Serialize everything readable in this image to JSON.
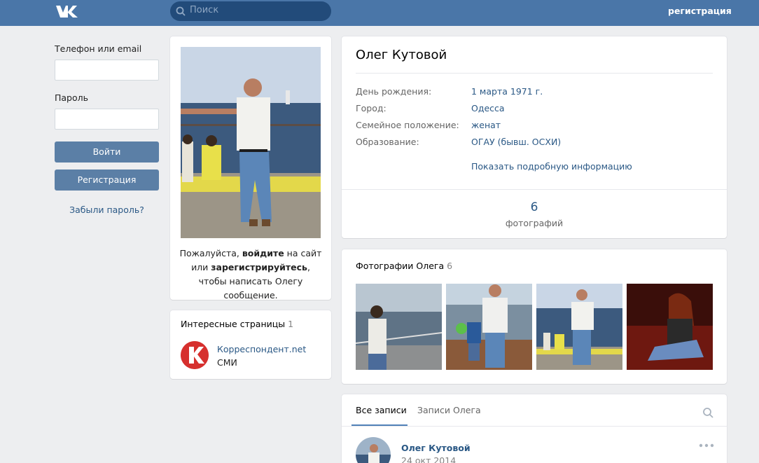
{
  "header": {
    "search_placeholder": "Поиск",
    "register_link": "регистрация"
  },
  "login": {
    "phone_label": "Телефон или email",
    "password_label": "Пароль",
    "login_button": "Войти",
    "register_button": "Регистрация",
    "forgot_link": "Забыли пароль?"
  },
  "profile": {
    "name": "Олег Кутовой",
    "note_prefix": "Пожалуйста, ",
    "note_login": "войдите",
    "note_middle": " на сайт или ",
    "note_register": "зарегистрируйтесь",
    "note_suffix": ", чтобы написать Олегу сообщение.",
    "fields": [
      {
        "label": "День рождения:",
        "value": "1 марта 1971 г."
      },
      {
        "label": "Город:",
        "value": "Одесса"
      },
      {
        "label": "Семейное положение:",
        "value": "женат"
      },
      {
        "label": "Образование:",
        "value": "ОГАУ (бывш. ОСХИ)"
      }
    ],
    "show_more": "Показать подробную информацию",
    "photo_count": "6",
    "photo_count_label": "фотографий"
  },
  "interesting": {
    "title": "Интересные страницы",
    "count": "1",
    "page_name": "Корреспондент.net",
    "page_category": "СМИ"
  },
  "photos": {
    "title": "Фотографии Олега",
    "count": "6"
  },
  "wall": {
    "tabs": [
      "Все записи",
      "Записи Олега"
    ],
    "post": {
      "author": "Олег Кутовой",
      "date": "24 окт 2014"
    }
  },
  "colors": {
    "brand": "#4a76a8",
    "link": "#2a5885",
    "button": "#5b7fa6"
  }
}
